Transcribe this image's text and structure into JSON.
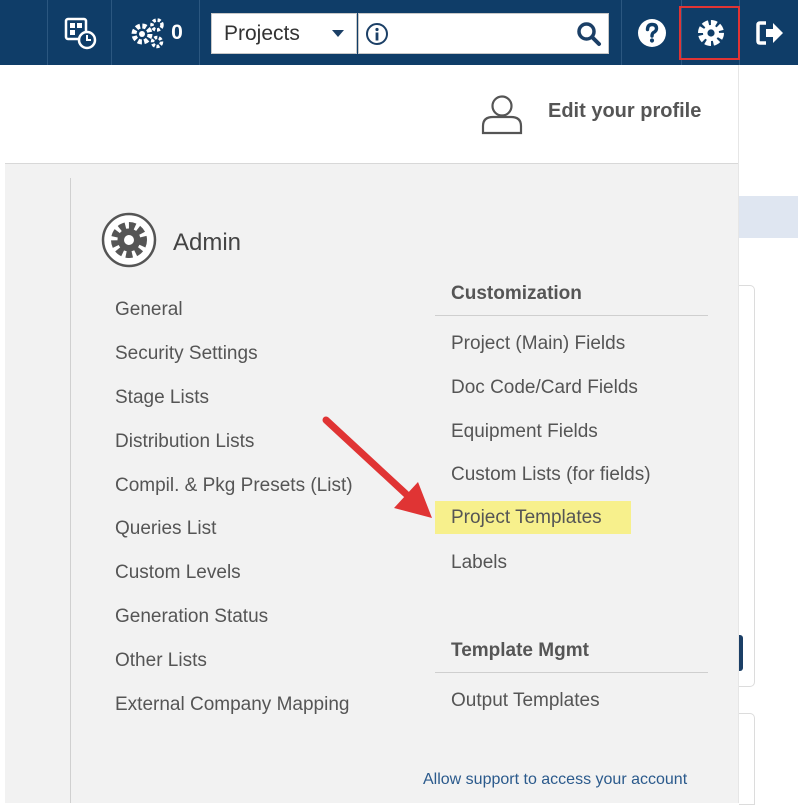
{
  "topbar": {
    "notifications_count": "0",
    "project_select": {
      "selected": "Projects"
    },
    "search": {
      "value": "",
      "placeholder": ""
    }
  },
  "profile": {
    "edit_label": "Edit your profile"
  },
  "admin": {
    "title": "Admin",
    "left_items": [
      "General",
      "Security Settings",
      "Stage Lists",
      "Distribution Lists",
      "Compil. & Pkg Presets (List)",
      "Queries List",
      "Custom Levels",
      "Generation Status",
      "Other Lists",
      "External Company Mapping"
    ],
    "customization": {
      "heading": "Customization",
      "items": [
        "Project (Main) Fields",
        "Doc Code/Card Fields",
        "Equipment Fields",
        "Custom Lists (for fields)",
        "Project Templates",
        "Labels"
      ]
    },
    "template_mgmt": {
      "heading": "Template Mgmt",
      "items": [
        "Output Templates"
      ]
    },
    "support_link": "Allow support to access your account"
  },
  "colors": {
    "topbar": "#0f3d68",
    "highlight": "#f7f08c",
    "callout": "#e03434",
    "link": "#2b5a8c"
  }
}
